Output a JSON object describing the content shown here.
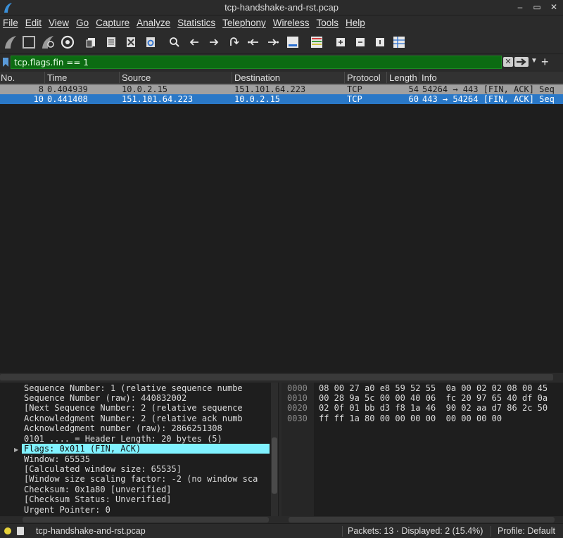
{
  "window": {
    "title": "tcp-handshake-and-rst.pcap",
    "controls": [
      "–",
      "▭",
      "✕"
    ]
  },
  "menu": [
    "File",
    "Edit",
    "View",
    "Go",
    "Capture",
    "Analyze",
    "Statistics",
    "Telephony",
    "Wireless",
    "Tools",
    "Help"
  ],
  "filter": {
    "value": "tcp.flags.fin == 1"
  },
  "packet_list": {
    "columns": [
      "No.",
      "Time",
      "Source",
      "Destination",
      "Protocol",
      "Length",
      "Info"
    ],
    "rows": [
      {
        "no": "8",
        "time": "0.404939",
        "source": "10.0.2.15",
        "destination": "151.101.64.223",
        "protocol": "TCP",
        "length": "54",
        "info": "54264 → 443 [FIN, ACK] Seq"
      },
      {
        "no": "10",
        "time": "0.441408",
        "source": "151.101.64.223",
        "destination": "10.0.2.15",
        "protocol": "TCP",
        "length": "60",
        "info": "443 → 54264 [FIN, ACK] Seq"
      }
    ]
  },
  "details": {
    "lines": [
      "Sequence Number: 1    (relative sequence numbe",
      "Sequence Number (raw): 440832002",
      "[Next Sequence Number: 2    (relative sequence",
      "Acknowledgment Number: 2    (relative ack numb",
      "Acknowledgment number (raw): 2866251308",
      "0101 .... = Header Length: 20 bytes (5)",
      "Flags: 0x011 (FIN, ACK)",
      "Window: 65535",
      "[Calculated window size: 65535]",
      "[Window size scaling factor: -2 (no window sca",
      "Checksum: 0x1a80 [unverified]",
      "[Checksum Status: Unverified]",
      "Urgent Pointer: 0"
    ],
    "selected_index": 6
  },
  "bytes": {
    "offsets": [
      "0000",
      "0010",
      "0020",
      "0030"
    ],
    "hex": [
      "08 00 27 a0 e8 59 52 55  0a 00 02 02 08 00 45",
      "00 28 9a 5c 00 00 40 06  fc 20 97 65 40 df 0a",
      "02 0f 01 bb d3 f8 1a 46  90 02 aa d7 86 2c 50",
      "ff ff 1a 80 00 00 00 00  00 00 00 00"
    ]
  },
  "status": {
    "file": "tcp-handshake-and-rst.pcap",
    "packets": "Packets: 13 · Displayed: 2 (15.4%)",
    "profile": "Profile: Default"
  },
  "colors": {
    "filter_valid": "#0c6b12",
    "selected_row": "#2a78c7",
    "marked_row": "#a0a0a0",
    "selected_field": "#80f2ff"
  }
}
